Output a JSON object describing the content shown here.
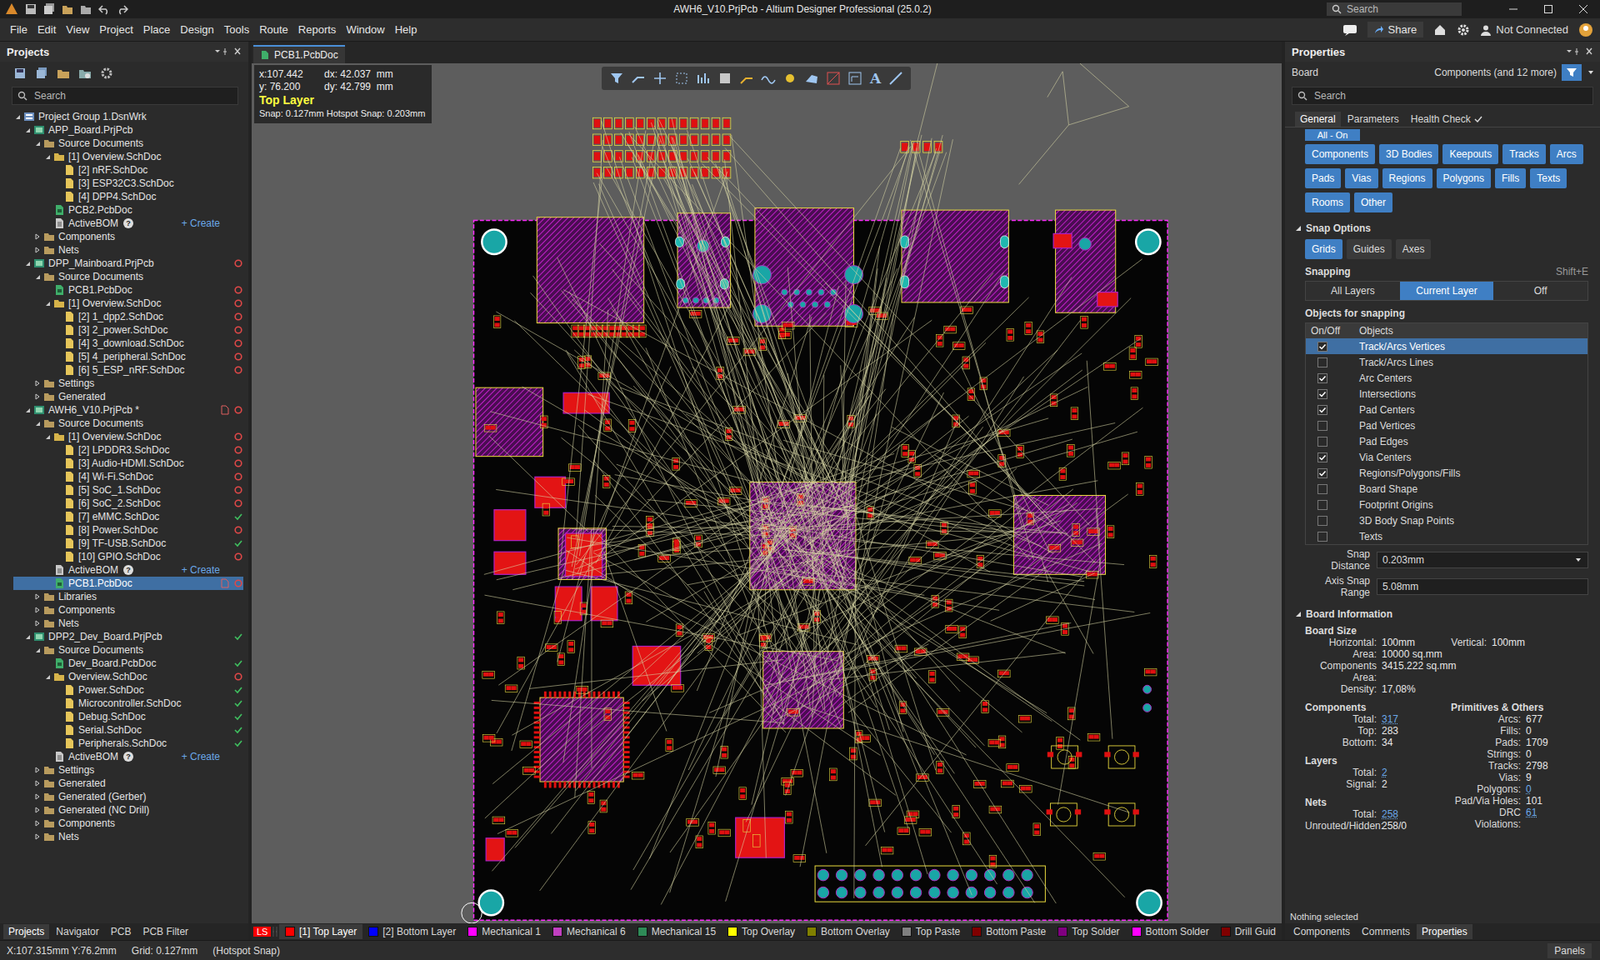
{
  "window": {
    "title": "AWH6_V10.PrjPcb - Altium Designer Professional (25.0.2)",
    "search_placeholder": "Search"
  },
  "menu": [
    "File",
    "Edit",
    "View",
    "Project",
    "Place",
    "Design",
    "Tools",
    "Route",
    "Reports",
    "Window",
    "Help"
  ],
  "menu_right": {
    "share": "Share",
    "connection": "Not Connected"
  },
  "projects_panel": {
    "title": "Projects",
    "search_placeholder": "Search",
    "tree": [
      {
        "label": "Project Group 1.DsnWrk",
        "depth": 0,
        "kind": "group",
        "toggle": "open",
        "status": "none",
        "selected": false
      },
      {
        "label": "APP_Board.PrjPcb",
        "depth": 1,
        "kind": "project",
        "toggle": "open",
        "status": "none",
        "selected": false
      },
      {
        "label": "Source Documents",
        "depth": 2,
        "kind": "folder",
        "toggle": "open",
        "status": "none",
        "selected": false
      },
      {
        "label": "[1] Overview.SchDoc",
        "depth": 3,
        "kind": "sheets",
        "toggle": "open",
        "status": "none",
        "selected": false
      },
      {
        "label": "[2] nRF.SchDoc",
        "depth": 4,
        "kind": "schdoc",
        "toggle": "none",
        "status": "none",
        "selected": false
      },
      {
        "label": "[3] ESP32C3.SchDoc",
        "depth": 4,
        "kind": "schdoc",
        "toggle": "none",
        "status": "none",
        "selected": false
      },
      {
        "label": "[4] DPP4.SchDoc",
        "depth": 4,
        "kind": "schdoc",
        "toggle": "none",
        "status": "none",
        "selected": false
      },
      {
        "label": "PCB2.PcbDoc",
        "depth": 3,
        "kind": "pcbdoc",
        "toggle": "none",
        "status": "none",
        "selected": false
      },
      {
        "label": "ActiveBOM",
        "depth": 3,
        "kind": "bom",
        "toggle": "none",
        "status": "none",
        "selected": false,
        "note": "?",
        "action": "+ Create"
      },
      {
        "label": "Components",
        "depth": 2,
        "kind": "folder",
        "toggle": "closed",
        "status": "none",
        "selected": false
      },
      {
        "label": "Nets",
        "depth": 2,
        "kind": "folder",
        "toggle": "closed",
        "status": "none",
        "selected": false
      },
      {
        "label": "DPP_Mainboard.PrjPcb",
        "depth": 1,
        "kind": "project",
        "toggle": "open",
        "status": "modified",
        "selected": false
      },
      {
        "label": "Source Documents",
        "depth": 2,
        "kind": "folder",
        "toggle": "open",
        "status": "none",
        "selected": false
      },
      {
        "label": "PCB1.PcbDoc",
        "depth": 3,
        "kind": "pcbdoc",
        "toggle": "none",
        "status": "modified",
        "selected": false
      },
      {
        "label": "[1] Overview.SchDoc",
        "depth": 3,
        "kind": "sheets",
        "toggle": "open",
        "status": "modified",
        "selected": false
      },
      {
        "label": "[2] 1_dpp2.SchDoc",
        "depth": 4,
        "kind": "schdoc",
        "toggle": "none",
        "status": "modified",
        "selected": false
      },
      {
        "label": "[3] 2_power.SchDoc",
        "depth": 4,
        "kind": "schdoc",
        "toggle": "none",
        "status": "modified",
        "selected": false
      },
      {
        "label": "[4] 3_download.SchDoc",
        "depth": 4,
        "kind": "schdoc",
        "toggle": "none",
        "status": "modified",
        "selected": false
      },
      {
        "label": "[5] 4_peripheral.SchDoc",
        "depth": 4,
        "kind": "schdoc",
        "toggle": "none",
        "status": "modified",
        "selected": false
      },
      {
        "label": "[6] 5_ESP_nRF.SchDoc",
        "depth": 4,
        "kind": "schdoc",
        "toggle": "none",
        "status": "modified",
        "selected": false
      },
      {
        "label": "Settings",
        "depth": 2,
        "kind": "folder",
        "toggle": "closed",
        "status": "none",
        "selected": false
      },
      {
        "label": "Generated",
        "depth": 2,
        "kind": "folder",
        "toggle": "closed",
        "status": "none",
        "selected": false
      },
      {
        "label": "AWH6_V10.PrjPcb *",
        "depth": 1,
        "kind": "project",
        "toggle": "open",
        "status": "modified",
        "selected": false,
        "doc": true
      },
      {
        "label": "Source Documents",
        "depth": 2,
        "kind": "folder",
        "toggle": "open",
        "status": "none",
        "selected": false
      },
      {
        "label": "[1] Overview.SchDoc",
        "depth": 3,
        "kind": "sheets",
        "toggle": "open",
        "status": "modified",
        "selected": false
      },
      {
        "label": "[2] LPDDR3.SchDoc",
        "depth": 4,
        "kind": "schdoc",
        "toggle": "none",
        "status": "modified",
        "selected": false
      },
      {
        "label": "[3] Audio-HDMI.SchDoc",
        "depth": 4,
        "kind": "schdoc",
        "toggle": "none",
        "status": "modified",
        "selected": false
      },
      {
        "label": "[4] Wi-Fi.SchDoc",
        "depth": 4,
        "kind": "schdoc",
        "toggle": "none",
        "status": "modified",
        "selected": false
      },
      {
        "label": "[5] SoC_1.SchDoc",
        "depth": 4,
        "kind": "schdoc",
        "toggle": "none",
        "status": "modified",
        "selected": false
      },
      {
        "label": "[6] SoC_2.SchDoc",
        "depth": 4,
        "kind": "schdoc",
        "toggle": "none",
        "status": "modified",
        "selected": false
      },
      {
        "label": "[7] eMMC.SchDoc",
        "depth": 4,
        "kind": "schdoc",
        "toggle": "none",
        "status": "saved",
        "selected": false
      },
      {
        "label": "[8] Power.SchDoc",
        "depth": 4,
        "kind": "schdoc",
        "toggle": "none",
        "status": "modified",
        "selected": false
      },
      {
        "label": "[9] TF-USB.SchDoc",
        "depth": 4,
        "kind": "schdoc",
        "toggle": "none",
        "status": "saved",
        "selected": false
      },
      {
        "label": "[10] GPIO.SchDoc",
        "depth": 4,
        "kind": "schdoc",
        "toggle": "none",
        "status": "modified",
        "selected": false
      },
      {
        "label": "ActiveBOM",
        "depth": 3,
        "kind": "bom",
        "toggle": "none",
        "status": "none",
        "selected": false,
        "note": "?",
        "action": "+ Create"
      },
      {
        "label": "PCB1.PcbDoc",
        "depth": 3,
        "kind": "pcbdoc",
        "toggle": "none",
        "status": "modified",
        "selected": true,
        "doc": true
      },
      {
        "label": "Libraries",
        "depth": 2,
        "kind": "folder",
        "toggle": "closed",
        "status": "none",
        "selected": false
      },
      {
        "label": "Components",
        "depth": 2,
        "kind": "folder",
        "toggle": "closed",
        "status": "none",
        "selected": false
      },
      {
        "label": "Nets",
        "depth": 2,
        "kind": "folder",
        "toggle": "closed",
        "status": "none",
        "selected": false
      },
      {
        "label": "DPP2_Dev_Board.PrjPcb",
        "depth": 1,
        "kind": "project",
        "toggle": "open",
        "status": "saved",
        "selected": false
      },
      {
        "label": "Source Documents",
        "depth": 2,
        "kind": "folder",
        "toggle": "open",
        "status": "none",
        "selected": false
      },
      {
        "label": "Dev_Board.PcbDoc",
        "depth": 3,
        "kind": "pcbdoc",
        "toggle": "none",
        "status": "saved",
        "selected": false
      },
      {
        "label": "Overview.SchDoc",
        "depth": 3,
        "kind": "sheets",
        "toggle": "open",
        "status": "modified",
        "selected": false
      },
      {
        "label": "Power.SchDoc",
        "depth": 4,
        "kind": "schdoc",
        "toggle": "none",
        "status": "saved",
        "selected": false
      },
      {
        "label": "Microcontroller.SchDoc",
        "depth": 4,
        "kind": "schdoc",
        "toggle": "none",
        "status": "saved",
        "selected": false
      },
      {
        "label": "Debug.SchDoc",
        "depth": 4,
        "kind": "schdoc",
        "toggle": "none",
        "status": "saved",
        "selected": false
      },
      {
        "label": "Serial.SchDoc",
        "depth": 4,
        "kind": "schdoc",
        "toggle": "none",
        "status": "saved",
        "selected": false
      },
      {
        "label": "Peripherals.SchDoc",
        "depth": 4,
        "kind": "schdoc",
        "toggle": "none",
        "status": "saved",
        "selected": false
      },
      {
        "label": "ActiveBOM",
        "depth": 3,
        "kind": "bom",
        "toggle": "none",
        "status": "none",
        "selected": false,
        "note": "?",
        "action": "+ Create"
      },
      {
        "label": "Settings",
        "depth": 2,
        "kind": "folder",
        "toggle": "closed",
        "status": "none",
        "selected": false
      },
      {
        "label": "Generated",
        "depth": 2,
        "kind": "folder",
        "toggle": "closed",
        "status": "none",
        "selected": false
      },
      {
        "label": "Generated (Gerber)",
        "depth": 2,
        "kind": "folder",
        "toggle": "closed",
        "status": "none",
        "selected": false
      },
      {
        "label": "Generated (NC Drill)",
        "depth": 2,
        "kind": "folder",
        "toggle": "closed",
        "status": "none",
        "selected": false
      },
      {
        "label": "Components",
        "depth": 2,
        "kind": "folder",
        "toggle": "closed",
        "status": "none",
        "selected": false
      },
      {
        "label": "Nets",
        "depth": 2,
        "kind": "folder",
        "toggle": "closed",
        "status": "none",
        "selected": false
      }
    ],
    "bottom_tabs": [
      {
        "label": "Projects",
        "selected": true
      },
      {
        "label": "Navigator",
        "selected": false
      },
      {
        "label": "PCB",
        "selected": false
      },
      {
        "label": "PCB Filter",
        "selected": false
      }
    ]
  },
  "document_tab": {
    "label": "PCB1.PcbDoc",
    "selected": true
  },
  "canvas": {
    "toolbar_text": "A",
    "readout": {
      "x": "x:107.442",
      "dx": "dx: 42.037  mm",
      "y": "y: 76.200",
      "dy": "dy: 42.799  mm",
      "layer": "Top Layer",
      "snap": "Snap: 0.127mm Hotspot Snap: 0.203mm"
    }
  },
  "layer_bar": {
    "set_label": "LS",
    "set_color": "#ff0000",
    "layers": [
      {
        "label": "[1] Top Layer",
        "color": "#ff0000",
        "selected": true
      },
      {
        "label": "[2] Bottom Layer",
        "color": "#0000ff",
        "selected": false
      },
      {
        "label": "Mechanical 1",
        "color": "#ff00ff",
        "selected": false
      },
      {
        "label": "Mechanical 6",
        "color": "#c040c0",
        "selected": false
      },
      {
        "label": "Mechanical 15",
        "color": "#2e8b57",
        "selected": false
      },
      {
        "label": "Top Overlay",
        "color": "#ffff00",
        "selected": false
      },
      {
        "label": "Bottom Overlay",
        "color": "#808000",
        "selected": false
      },
      {
        "label": "Top Paste",
        "color": "#808080",
        "selected": false
      },
      {
        "label": "Bottom Paste",
        "color": "#800000",
        "selected": false
      },
      {
        "label": "Top Solder",
        "color": "#800080",
        "selected": false
      },
      {
        "label": "Bottom Solder",
        "color": "#ff00ff",
        "selected": false
      },
      {
        "label": "Drill Guid",
        "color": "#800000",
        "selected": false
      }
    ]
  },
  "properties": {
    "title": "Properties",
    "object": "Board",
    "filter_summary": "Components (and 12 more)",
    "search_placeholder": "Search",
    "tabs": [
      {
        "label": "General",
        "selected": true
      },
      {
        "label": "Parameters",
        "selected": false
      },
      {
        "label": "Health Check",
        "selected": false
      }
    ],
    "all_on": "All - On",
    "filters": [
      {
        "label": "Components",
        "selected": true
      },
      {
        "label": "3D Bodies",
        "selected": true
      },
      {
        "label": "Keepouts",
        "selected": true
      },
      {
        "label": "Tracks",
        "selected": true
      },
      {
        "label": "Arcs",
        "selected": true
      },
      {
        "label": "Pads",
        "selected": true
      },
      {
        "label": "Vias",
        "selected": true
      },
      {
        "label": "Regions",
        "selected": true
      },
      {
        "label": "Polygons",
        "selected": true
      },
      {
        "label": "Fills",
        "selected": true
      },
      {
        "label": "Texts",
        "selected": true
      },
      {
        "label": "Rooms",
        "selected": true
      },
      {
        "label": "Other",
        "selected": true
      }
    ],
    "snap_options": {
      "title": "Snap Options",
      "modes": [
        {
          "label": "Grids",
          "selected": true
        },
        {
          "label": "Guides",
          "selected": false
        },
        {
          "label": "Axes",
          "selected": false
        }
      ],
      "snapping_label": "Snapping",
      "snapping_shortcut": "Shift+E",
      "scope": [
        {
          "label": "All Layers",
          "selected": false
        },
        {
          "label": "Current Layer",
          "selected": true
        },
        {
          "label": "Off",
          "selected": false
        }
      ],
      "objects_title": "Objects for snapping",
      "columns": [
        "On/Off",
        "Objects"
      ],
      "objects": [
        {
          "label": "Track/Arcs Vertices",
          "checked": true,
          "selected": true
        },
        {
          "label": "Track/Arcs Lines",
          "checked": false,
          "selected": false
        },
        {
          "label": "Arc Centers",
          "checked": true,
          "selected": false
        },
        {
          "label": "Intersections",
          "checked": true,
          "selected": false
        },
        {
          "label": "Pad Centers",
          "checked": true,
          "selected": false
        },
        {
          "label": "Pad Vertices",
          "checked": false,
          "selected": false
        },
        {
          "label": "Pad Edges",
          "checked": false,
          "selected": false
        },
        {
          "label": "Via Centers",
          "checked": true,
          "selected": false
        },
        {
          "label": "Regions/Polygons/Fills",
          "checked": true,
          "selected": false
        },
        {
          "label": "Board Shape",
          "checked": false,
          "selected": false
        },
        {
          "label": "Footprint Origins",
          "checked": false,
          "selected": false
        },
        {
          "label": "3D Body Snap Points",
          "checked": false,
          "selected": false
        },
        {
          "label": "Texts",
          "checked": false,
          "selected": false
        }
      ],
      "fields": [
        {
          "label": "Snap Distance",
          "value": "0.203mm",
          "kind": "dropdown"
        },
        {
          "label": "Axis Snap Range",
          "value": "5.08mm",
          "kind": "text"
        }
      ]
    },
    "board_information": {
      "title": "Board Information",
      "size_title": "Board Size",
      "horizontal": {
        "label": "Horizontal:",
        "value": "100mm"
      },
      "vertical": {
        "label": "Vertical:",
        "value": "100mm"
      },
      "size_rows": [
        {
          "label": "Area:",
          "value": "10000 sq.mm"
        },
        {
          "label": "Components Area:",
          "value": "3415.222 sq.mm"
        },
        {
          "label": "Density:",
          "value": "17,08%"
        }
      ],
      "left_groups": [
        {
          "title": "Components",
          "rows": [
            {
              "label": "Total:",
              "value": "317",
              "link": true
            },
            {
              "label": "Top:",
              "value": "283",
              "link": false
            },
            {
              "label": "Bottom:",
              "value": "34",
              "link": false
            }
          ]
        },
        {
          "title": "Layers",
          "rows": [
            {
              "label": "Total:",
              "value": "2",
              "link": true
            },
            {
              "label": "Signal:",
              "value": "2",
              "link": false
            }
          ]
        },
        {
          "title": "Nets",
          "rows": [
            {
              "label": "Total:",
              "value": "258",
              "link": true
            },
            {
              "label": "Unrouted/Hidden:",
              "value": "258/0",
              "link": false
            }
          ]
        }
      ],
      "right_group": {
        "title": "Primitives & Others",
        "rows": [
          {
            "label": "Arcs:",
            "value": "677",
            "link": false
          },
          {
            "label": "Fills:",
            "value": "0",
            "link": false
          },
          {
            "label": "Pads:",
            "value": "1709",
            "link": false
          },
          {
            "label": "Strings:",
            "value": "0",
            "link": false
          },
          {
            "label": "Tracks:",
            "value": "2798",
            "link": false
          },
          {
            "label": "Vias:",
            "value": "9",
            "link": false
          },
          {
            "label": "Polygons:",
            "value": "0",
            "link": true
          },
          {
            "label": "Pad/Via Holes:",
            "value": "101",
            "link": false
          },
          {
            "label": "DRC Violations:",
            "value": "61",
            "link": true
          }
        ]
      }
    },
    "selection": "Nothing selected",
    "bottom_tabs": [
      {
        "label": "Components",
        "selected": false
      },
      {
        "label": "Comments",
        "selected": false
      },
      {
        "label": "Properties",
        "selected": true
      }
    ]
  },
  "status_bar": {
    "coords": "X:107.315mm Y:76.2mm",
    "grid": "Grid: 0.127mm",
    "snap": "(Hotspot Snap)",
    "panels": "Panels"
  }
}
